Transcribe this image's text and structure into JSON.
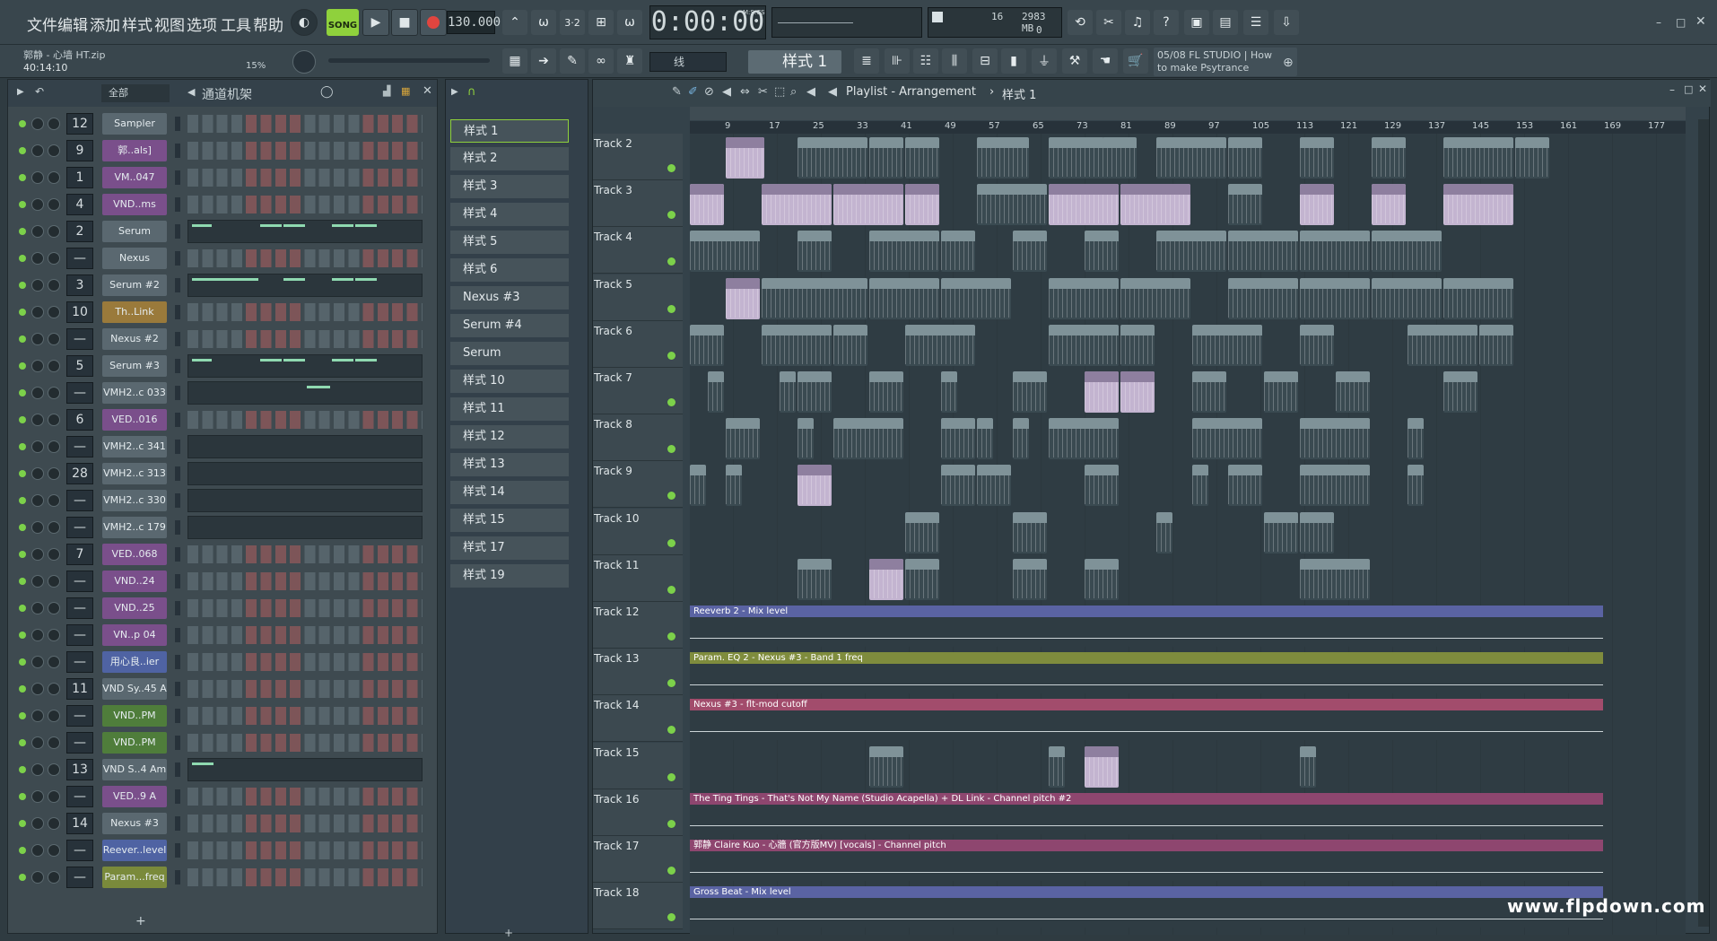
{
  "menu": [
    "文件",
    "编辑",
    "添加",
    "样式",
    "视图",
    "选项",
    "工具",
    "帮助"
  ],
  "transport": {
    "mode_label": "SONG",
    "tempo": "130.000",
    "time": "0:00:00",
    "time_unit": "M:S:CS",
    "cpu_label": "16",
    "mem_label": "2983 MB",
    "voices": "0",
    "pattern_label": "样式 1"
  },
  "project": {
    "file": "郭静 - 心墙 HT.zip",
    "duration": "40:14:10",
    "zoom": "15%"
  },
  "snap": {
    "value": "线"
  },
  "hint": {
    "date": "05/08",
    "text1": "FL STUDIO | How",
    "text2": "to make Psytrance"
  },
  "channel_rack": {
    "filter": "全部",
    "title": "通道机架",
    "channels": [
      {
        "num": "12",
        "name": "Sampler",
        "kind": "steps"
      },
      {
        "num": "9",
        "name": "郭..als]",
        "kind": "steps"
      },
      {
        "num": "1",
        "name": "VM..047",
        "kind": "steps"
      },
      {
        "num": "4",
        "name": "VND..ms",
        "kind": "steps"
      },
      {
        "num": "2",
        "name": "Serum",
        "kind": "piano"
      },
      {
        "num": "—",
        "name": "Nexus",
        "kind": "steps"
      },
      {
        "num": "3",
        "name": "Serum #2",
        "kind": "piano"
      },
      {
        "num": "10",
        "name": "Th..Link",
        "kind": "steps"
      },
      {
        "num": "—",
        "name": "Nexus #2",
        "kind": "steps"
      },
      {
        "num": "5",
        "name": "Serum #3",
        "kind": "piano"
      },
      {
        "num": "—",
        "name": "VMH2..c 033",
        "kind": "piano"
      },
      {
        "num": "6",
        "name": "VED..016",
        "kind": "steps"
      },
      {
        "num": "—",
        "name": "VMH2..c 341",
        "kind": "piano"
      },
      {
        "num": "28",
        "name": "VMH2..c 313",
        "kind": "piano"
      },
      {
        "num": "—",
        "name": "VMH2..c 330",
        "kind": "piano"
      },
      {
        "num": "—",
        "name": "VMH2..c 179",
        "kind": "piano"
      },
      {
        "num": "7",
        "name": "VED..068",
        "kind": "steps"
      },
      {
        "num": "—",
        "name": "VND..24",
        "kind": "steps"
      },
      {
        "num": "—",
        "name": "VND..25",
        "kind": "steps"
      },
      {
        "num": "—",
        "name": "VN..p 04",
        "kind": "steps"
      },
      {
        "num": "—",
        "name": "用心良..ier",
        "kind": "steps"
      },
      {
        "num": "11",
        "name": "VND Sy..45 A",
        "kind": "steps"
      },
      {
        "num": "—",
        "name": "VND..PM",
        "kind": "steps"
      },
      {
        "num": "—",
        "name": "VND..PM",
        "kind": "steps"
      },
      {
        "num": "13",
        "name": "VND S..4 Am",
        "kind": "piano"
      },
      {
        "num": "—",
        "name": "VED..9 A",
        "kind": "steps"
      },
      {
        "num": "14",
        "name": "Nexus #3",
        "kind": "steps"
      },
      {
        "num": "—",
        "name": "Reever..level",
        "kind": "steps"
      },
      {
        "num": "—",
        "name": "Param...freq",
        "kind": "steps"
      }
    ]
  },
  "patterns": [
    "样式 1",
    "样式 2",
    "样式 3",
    "样式 4",
    "样式 5",
    "样式 6",
    "Nexus #3",
    "Serum #4",
    "Serum",
    "样式 10",
    "样式 11",
    "样式 12",
    "样式 13",
    "样式 14",
    "样式 15",
    "样式 17",
    "样式 19"
  ],
  "playlist": {
    "title": "Playlist - Arrangement",
    "pattern": "样式 1",
    "bars": [
      "9",
      "17",
      "25",
      "33",
      "41",
      "49",
      "57",
      "65",
      "73",
      "81",
      "89",
      "97",
      "105",
      "113",
      "121",
      "129",
      "137",
      "145",
      "153",
      "161",
      "169",
      "177"
    ],
    "tracks": [
      "Track 2",
      "Track 3",
      "Track 4",
      "Track 5",
      "Track 6",
      "Track 7",
      "Track 8",
      "Track 9",
      "Track 10",
      "Track 11",
      "Track 12",
      "Track 13",
      "Track 14",
      "Track 15",
      "Track 16",
      "Track 17",
      "Track 18"
    ],
    "automation": [
      {
        "track": 10,
        "label": "Reeverb 2 - Mix level",
        "color": "#5a63a3"
      },
      {
        "track": 11,
        "label": "Param. EQ 2 - Nexus #3 - Band 1 freq",
        "color": "#7f8c3d"
      },
      {
        "track": 12,
        "label": "Nexus #3 - flt-mod cutoff",
        "color": "#a24c6c"
      },
      {
        "track": 14,
        "label": "The Ting Tings - That's Not My Name (Studio Acapella) + DL Link - Channel pitch #2",
        "color": "#8e466f"
      },
      {
        "track": 15,
        "label": "郭静 Claire Kuo - 心牆 (官方版MV) [vocals] - Channel pitch",
        "color": "#8e466f"
      },
      {
        "track": 16,
        "label": "Gross Beat - Mix level",
        "color": "#5a63a3"
      }
    ]
  },
  "watermark": "www.flpdown.com"
}
